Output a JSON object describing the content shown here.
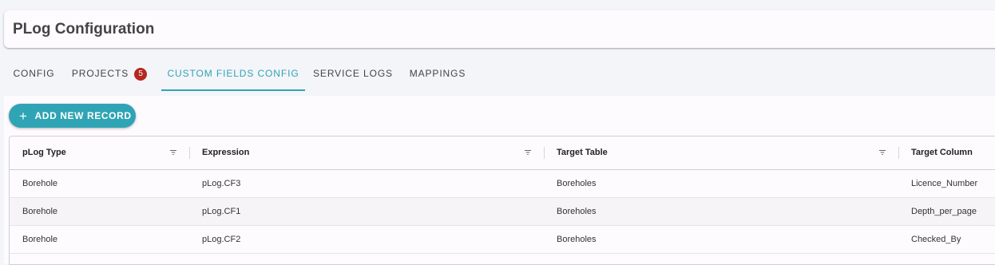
{
  "header": {
    "title": "PLog Configuration"
  },
  "tabs": [
    {
      "label": "CONFIG"
    },
    {
      "label": "PROJECTS",
      "badge": "5"
    },
    {
      "label": "CUSTOM FIELDS CONFIG",
      "active": true
    },
    {
      "label": "SERVICE LOGS"
    },
    {
      "label": "MAPPINGS"
    }
  ],
  "toolbar": {
    "add_icon": "+",
    "add_label": "ADD NEW RECORD"
  },
  "table": {
    "columns": [
      "pLog Type",
      "Expression",
      "Target Table",
      "Target Column"
    ],
    "rows": [
      [
        "Borehole",
        "pLog.CF3",
        "Boreholes",
        "Licence_Number"
      ],
      [
        "Borehole",
        "pLog.CF1",
        "Boreholes",
        "Depth_per_page"
      ],
      [
        "Borehole",
        "pLog.CF2",
        "Boreholes",
        "Checked_By"
      ]
    ]
  },
  "colors": {
    "accent": "#2fa4b5",
    "badge": "#b5271f",
    "background": "#f4f5f9",
    "card": "#fefbfe"
  },
  "icons": {
    "add": "plus-icon",
    "filter": "filter-icon"
  }
}
